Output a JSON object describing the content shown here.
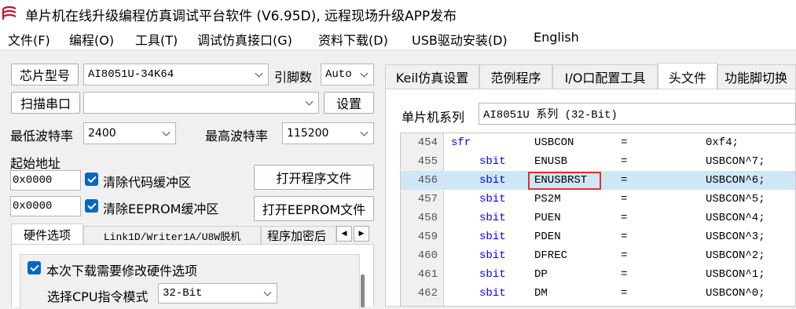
{
  "window": {
    "title": "单片机在线升级编程仿真调试平台软件 (V6.95D), 远程现场升级APP发布"
  },
  "menu": [
    "文件(F)",
    "编程(O)",
    "工具(T)",
    "调试仿真接口(G)",
    "资料下载(D)",
    "USB驱动安装(D)",
    "English"
  ],
  "left": {
    "chip_button": "芯片型号",
    "chip_value": "AI8051U-34K64",
    "pins_label": "引脚数",
    "pins_value": "Auto",
    "scan_button": "扫描串口",
    "port_value": "",
    "settings_button": "设置",
    "min_baud_label": "最低波特率",
    "min_baud_value": "2400",
    "max_baud_label": "最高波特率",
    "max_baud_value": "115200",
    "start_addr_label": "起始地址",
    "code_addr": "0x0000",
    "clear_code_label": "清除代码缓冲区",
    "open_program_button": "打开程序文件",
    "eeprom_addr": "0x0000",
    "clear_eeprom_label": "清除EEPROM缓冲区",
    "open_eeprom_button": "打开EEPROM文件",
    "tabs": [
      "硬件选项",
      "Link1D/Writer1A/U8W脱机",
      "程序加密后"
    ],
    "modify_hw_label": "本次下载需要修改硬件选项",
    "cpu_mode_label": "选择CPU指令模式",
    "cpu_mode_value": "32-Bit"
  },
  "right": {
    "tabs": [
      "Keil仿真设置",
      "范例程序",
      "I/O口配置工具",
      "头文件",
      "功能脚切换"
    ],
    "series_label": "单片机系列",
    "series_value": "AI8051U 系列 (32-Bit)",
    "code_lines": [
      {
        "ln": "454",
        "kw": "sfr",
        "name": "USBCON",
        "eq": "=",
        "val": "0xf4;"
      },
      {
        "ln": "455",
        "kw": "sbit",
        "name": "ENUSB",
        "eq": "=",
        "val": "USBCON^7;"
      },
      {
        "ln": "456",
        "kw": "sbit",
        "name": "ENUSBRST",
        "eq": "=",
        "val": "USBCON^6;"
      },
      {
        "ln": "457",
        "kw": "sbit",
        "name": "PS2M",
        "eq": "=",
        "val": "USBCON^5;"
      },
      {
        "ln": "458",
        "kw": "sbit",
        "name": "PUEN",
        "eq": "=",
        "val": "USBCON^4;"
      },
      {
        "ln": "459",
        "kw": "sbit",
        "name": "PDEN",
        "eq": "=",
        "val": "USBCON^3;"
      },
      {
        "ln": "460",
        "kw": "sbit",
        "name": "DFREC",
        "eq": "=",
        "val": "USBCON^2;"
      },
      {
        "ln": "461",
        "kw": "sbit",
        "name": "DP",
        "eq": "=",
        "val": "USBCON^1;"
      },
      {
        "ln": "462",
        "kw": "sbit",
        "name": "DM",
        "eq": "=",
        "val": "USBCON^0;"
      }
    ],
    "highlighted_line": "456"
  },
  "colors": {
    "keyword": "#0000ff",
    "highlight": "#cfe6f7",
    "annotation_box": "#d9342b",
    "checkbox": "#0067c0"
  }
}
